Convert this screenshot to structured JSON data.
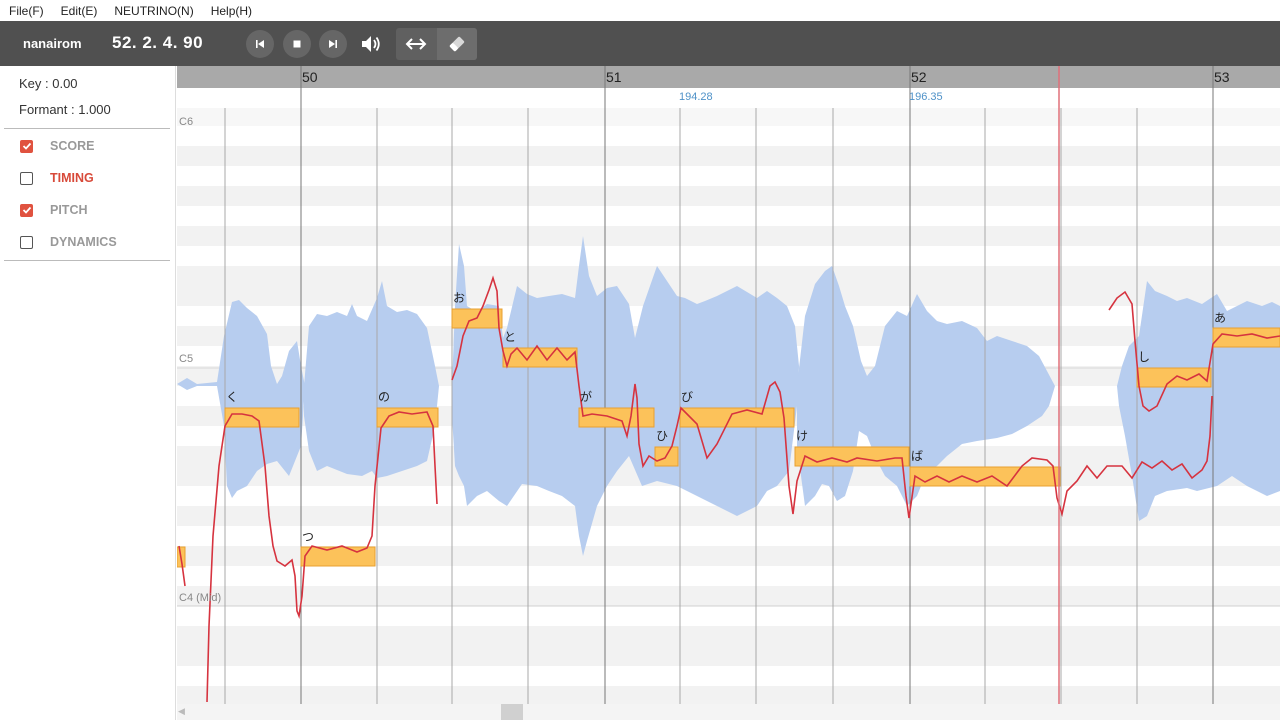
{
  "menu": [
    {
      "label": "File(F)"
    },
    {
      "label": "Edit(E)"
    },
    {
      "label": "NEUTRINO(N)"
    },
    {
      "label": "Help(H)"
    }
  ],
  "toolbar": {
    "app_name": "nanairom",
    "position": "52. 2. 4. 90",
    "buttons": [
      {
        "name": "skip-back-button",
        "icon": "skip-back-icon"
      },
      {
        "name": "stop-button",
        "icon": "stop-icon"
      },
      {
        "name": "skip-forward-button",
        "icon": "skip-forward-icon"
      }
    ],
    "volume_icon": "speaker-icon",
    "tools": [
      {
        "name": "tool-horizontal-resize",
        "icon": "horizontal-arrows-icon",
        "active": false
      },
      {
        "name": "tool-eraser",
        "icon": "eraser-icon",
        "active": true
      }
    ]
  },
  "sidebar": {
    "key_label": "Key : 0.00",
    "formant_label": "Formant : 1.000",
    "toggles": [
      {
        "label": "SCORE",
        "checked": true,
        "highlight": false
      },
      {
        "label": "TIMING",
        "checked": false,
        "highlight": true
      },
      {
        "label": "PITCH",
        "checked": true,
        "highlight": false
      },
      {
        "label": "DYNAMICS",
        "checked": false,
        "highlight": false
      }
    ]
  },
  "editor": {
    "measures": [
      {
        "label": "50"
      },
      {
        "label": "51"
      },
      {
        "label": "52"
      },
      {
        "label": "53"
      }
    ],
    "tempos": [
      {
        "label": "194.28"
      },
      {
        "label": "196.35"
      }
    ],
    "pitch_labels": [
      {
        "label": "C6"
      },
      {
        "label": "C5"
      },
      {
        "label": "C4 (Mid)"
      }
    ],
    "notes": [
      {
        "lyric": ""
      },
      {
        "lyric": "く"
      },
      {
        "lyric": "つ"
      },
      {
        "lyric": "の"
      },
      {
        "lyric": "お"
      },
      {
        "lyric": "と"
      },
      {
        "lyric": "が"
      },
      {
        "lyric": "ひ"
      },
      {
        "lyric": "び"
      },
      {
        "lyric": "け"
      },
      {
        "lyric": "ば"
      },
      {
        "lyric": "し"
      },
      {
        "lyric": "あ"
      }
    ]
  },
  "colors": {
    "note_fill": "#fcc25a",
    "note_border": "#e8a030",
    "pitch_curve": "#d6333f",
    "waveform": "#b7cdef",
    "playhead": "#e0707a",
    "tempo_text": "#4f92c8",
    "checkbox_on": "#e0523f"
  }
}
